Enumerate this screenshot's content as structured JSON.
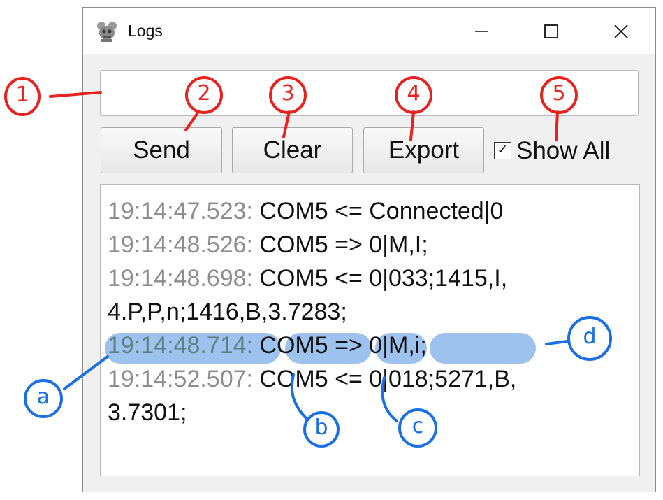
{
  "window": {
    "title": "Logs",
    "controls": {
      "minimize_icon": "minimize-icon",
      "maximize_icon": "maximize-icon",
      "close_icon": "close-icon"
    }
  },
  "command_input": {
    "value": "",
    "placeholder": ""
  },
  "toolbar": {
    "send_label": "Send",
    "clear_label": "Clear",
    "export_label": "Export",
    "show_all_label": "Show All",
    "show_all_checked": true,
    "check_glyph": "✓"
  },
  "log": {
    "lines": [
      {
        "time": "19:14:47.523:",
        "text": " COM5 <= Connected|0"
      },
      {
        "time": "19:14:48.526:",
        "text": " COM5 => 0|M,I;"
      },
      {
        "time": "19:14:48.698:",
        "text": " COM5 <= 0|033;1415,I,"
      },
      {
        "time": "",
        "text": "4.P,P,n;1416,B,3.7283;"
      },
      {
        "time": "19:14:48.714:",
        "text": " COM5 => 0|M,i;",
        "highlighted": true
      },
      {
        "time": "19:14:52.507:",
        "text": " COM5 <= 0|018;5271,B,"
      },
      {
        "time": "",
        "text": "3.7301;"
      }
    ]
  },
  "annotations": {
    "red": [
      "1",
      "2",
      "3",
      "4",
      "5"
    ],
    "blue": [
      "a",
      "b",
      "c",
      "d"
    ],
    "red_color": "#e8231f",
    "blue_color": "#1a6fe6",
    "highlight_color": "#9ec2ee"
  }
}
